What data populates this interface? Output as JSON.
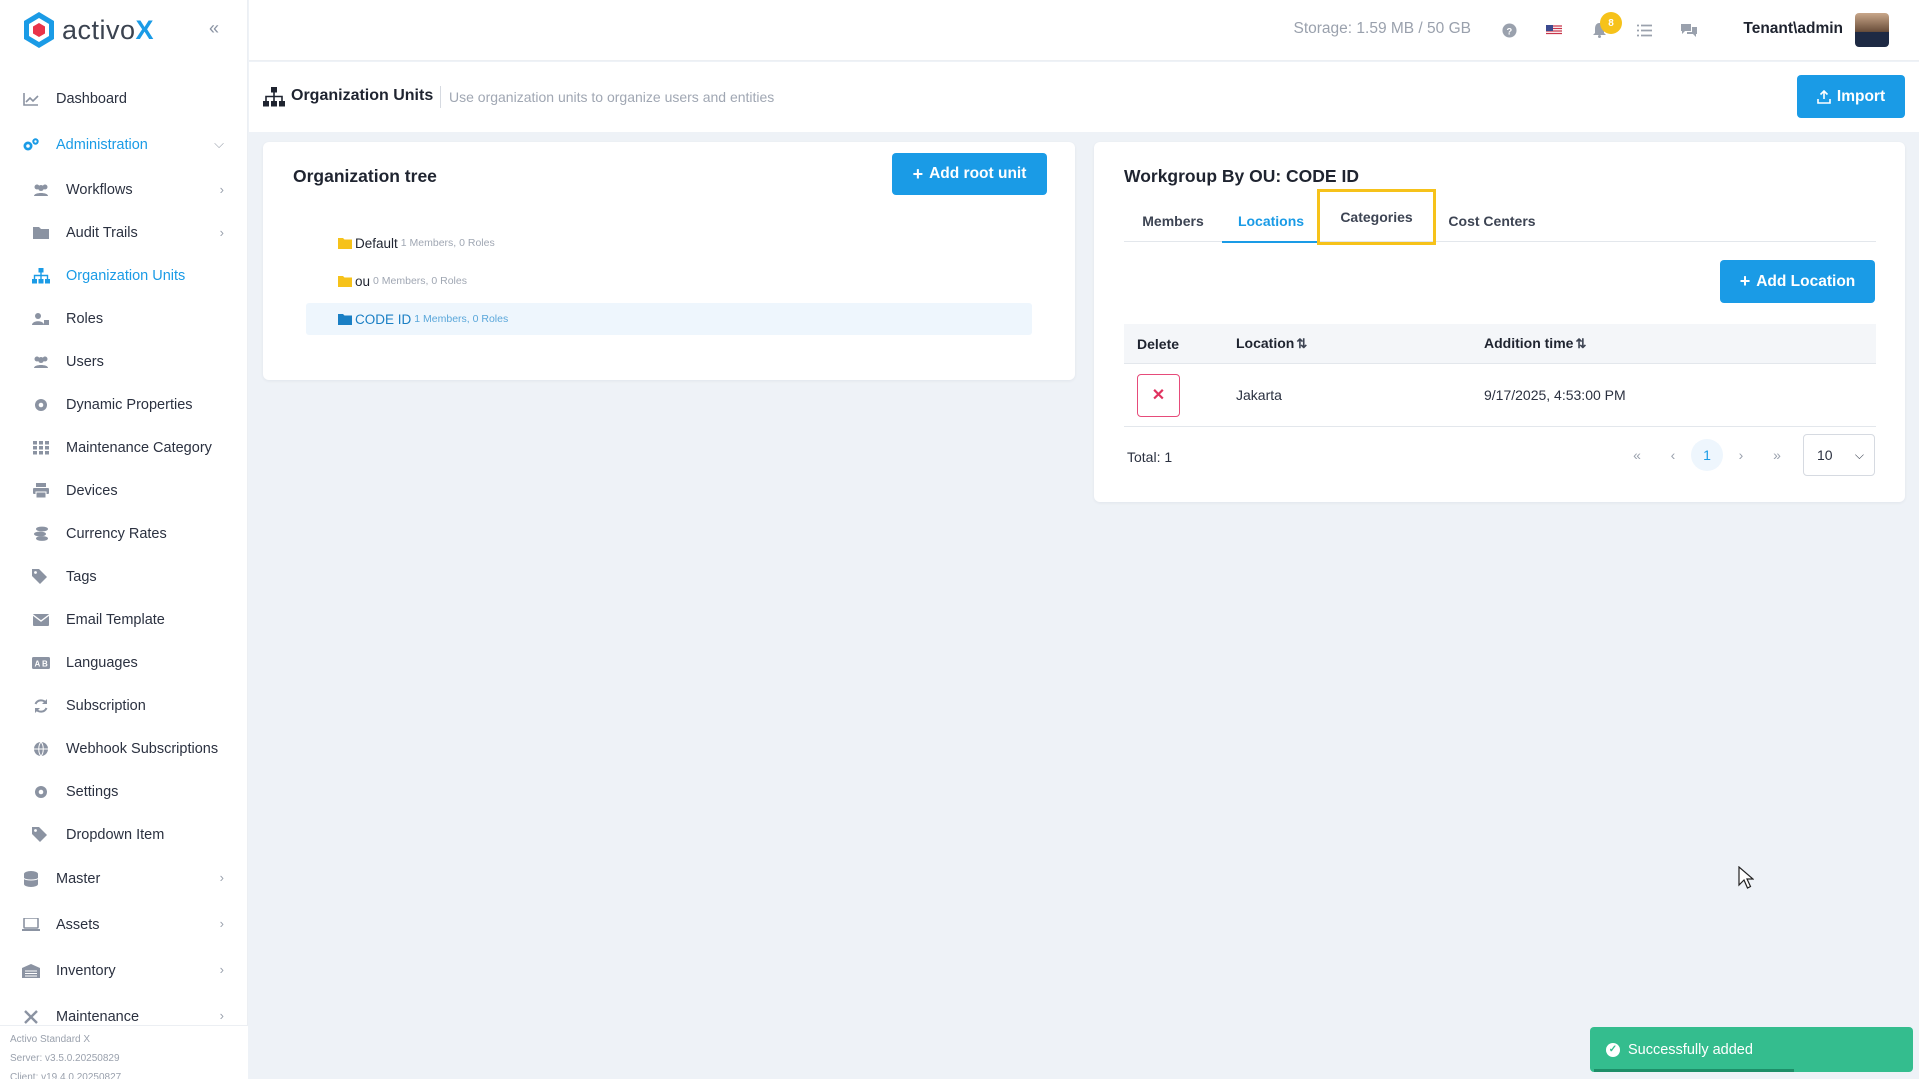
{
  "brand": {
    "name": "activo",
    "suffix": "X"
  },
  "sidebar": {
    "items": [
      {
        "label": "Dashboard",
        "icon": "chart-line-icon"
      },
      {
        "label": "Administration",
        "icon": "cogs-icon",
        "active": true,
        "expanded": true
      },
      {
        "label": "Workflows",
        "icon": "users-icon"
      },
      {
        "label": "Audit Trails",
        "icon": "folder-icon"
      },
      {
        "label": "Organization Units",
        "icon": "sitemap-icon",
        "active": true
      },
      {
        "label": "Roles",
        "icon": "user-tag-icon"
      },
      {
        "label": "Users",
        "icon": "users-icon"
      },
      {
        "label": "Dynamic Properties",
        "icon": "gear-icon"
      },
      {
        "label": "Maintenance Category",
        "icon": "grid-icon"
      },
      {
        "label": "Devices",
        "icon": "printer-icon"
      },
      {
        "label": "Currency Rates",
        "icon": "coins-icon"
      },
      {
        "label": "Tags",
        "icon": "tags-icon"
      },
      {
        "label": "Email Template",
        "icon": "envelope-icon"
      },
      {
        "label": "Languages",
        "icon": "language-icon"
      },
      {
        "label": "Subscription",
        "icon": "refresh-icon"
      },
      {
        "label": "Webhook Subscriptions",
        "icon": "globe-icon"
      },
      {
        "label": "Settings",
        "icon": "gear-icon"
      },
      {
        "label": "Dropdown Item",
        "icon": "tags-icon"
      },
      {
        "label": "Master",
        "icon": "database-icon"
      },
      {
        "label": "Assets",
        "icon": "laptop-icon"
      },
      {
        "label": "Inventory",
        "icon": "warehouse-icon"
      },
      {
        "label": "Maintenance",
        "icon": "tools-icon"
      }
    ],
    "footer": {
      "edition": "Activo Standard X",
      "server": "Server: v3.5.0.20250829",
      "client": "Client: v19.4.0.20250827"
    }
  },
  "topbar": {
    "storage": "Storage: 1.59 MB / 50 GB",
    "notification_count": "8",
    "user": "Tenant\\admin"
  },
  "subheader": {
    "title": "Organization Units",
    "description": "Use organization units to organize users and entities",
    "import_label": "Import"
  },
  "tree": {
    "title": "Organization tree",
    "add_root_label": "Add root unit",
    "units": [
      {
        "name": "Default",
        "meta": "1 Members, 0 Roles"
      },
      {
        "name": "ou",
        "meta": "0 Members, 0 Roles"
      },
      {
        "name": "CODE ID",
        "meta": "1 Members, 0 Roles",
        "selected": true
      }
    ]
  },
  "workgroup": {
    "title": "Workgroup By OU: CODE ID",
    "tabs": [
      "Members",
      "Locations",
      "Categories",
      "Cost Centers"
    ],
    "active_tab": "Locations",
    "add_location_label": "Add Location",
    "columns": [
      "Delete",
      "Location",
      "Addition time"
    ],
    "rows": [
      {
        "location": "Jakarta",
        "added": "9/17/2025, 4:53:00 PM"
      }
    ],
    "total": "Total: 1",
    "current_page": "1",
    "page_size": "10"
  },
  "toast": {
    "message": "Successfully added"
  },
  "colors": {
    "accent": "#1a9be6",
    "success": "#34bd8e",
    "highlight": "#f6c21a",
    "danger": "#e0325f"
  }
}
